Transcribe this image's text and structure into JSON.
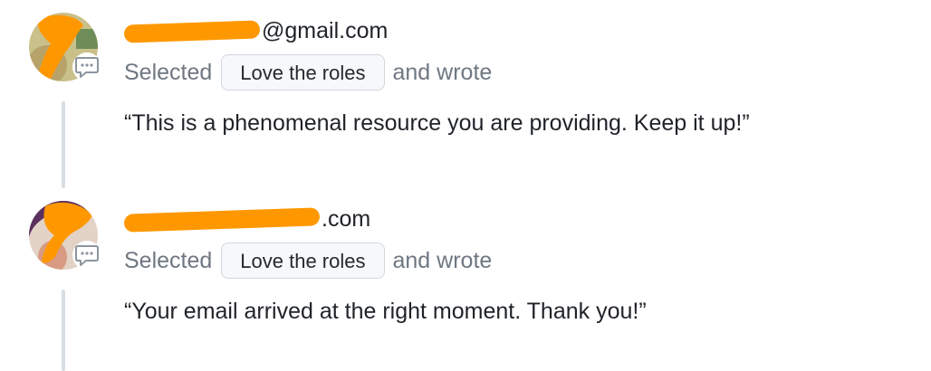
{
  "entries": [
    {
      "email_visible": "@gmail.com",
      "action_prefix": "Selected",
      "choice_label": "Love the roles",
      "action_suffix": "and wrote",
      "quote": "“This is a phenomenal resource you are providing. Keep it up!”"
    },
    {
      "email_visible": ".com",
      "action_prefix": "Selected",
      "choice_label": "Love the roles",
      "action_suffix": "and wrote",
      "quote": "“Your email arrived at the right moment. Thank you!”"
    }
  ],
  "icons": {
    "comment": "comment-icon",
    "redaction": "redaction-mark"
  },
  "colors": {
    "redaction": "#ff9800",
    "muted_text": "#6e7781",
    "pill_border": "#d0d7de",
    "thread_line": "#d8dee4"
  }
}
